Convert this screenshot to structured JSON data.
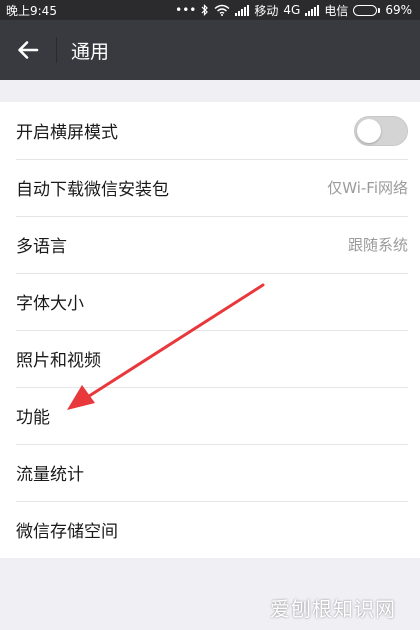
{
  "status_bar": {
    "time": "晚上9:45",
    "dots": "•••",
    "carrier1": "移动",
    "network": "4G",
    "carrier2": "电信",
    "battery_percent": "69%",
    "battery_level": 0.69
  },
  "header": {
    "back_icon": "arrow-left-icon",
    "title": "通用"
  },
  "settings": {
    "items": [
      {
        "label": "开启横屏模式",
        "value": "",
        "toggle": true,
        "toggle_on": false
      },
      {
        "label": "自动下载微信安装包",
        "value": "仅Wi-Fi网络"
      },
      {
        "label": "多语言",
        "value": "跟随系统"
      },
      {
        "label": "字体大小",
        "value": ""
      },
      {
        "label": "照片和视频",
        "value": ""
      },
      {
        "label": "功能",
        "value": ""
      },
      {
        "label": "流量统计",
        "value": ""
      },
      {
        "label": "微信存储空间",
        "value": ""
      }
    ]
  },
  "annotation": {
    "arrow_color": "#e8383b"
  },
  "watermark": {
    "text": "爱刨根知识网"
  }
}
